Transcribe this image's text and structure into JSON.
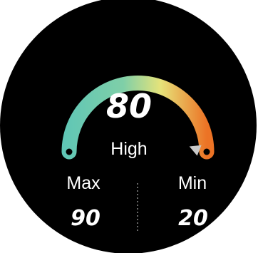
{
  "gauge": {
    "value": "80",
    "level_label": "High",
    "level_fraction": 0.8,
    "colors": {
      "background": "#000000",
      "start": "#5fc6b6",
      "mid": "#e6e37a",
      "end": "#ec7325",
      "pointer": "#c9c9c9",
      "divider": "#8a8a8a"
    }
  },
  "stats": {
    "max_label": "Max",
    "max_value": "90",
    "min_label": "Min",
    "min_value": "20"
  }
}
